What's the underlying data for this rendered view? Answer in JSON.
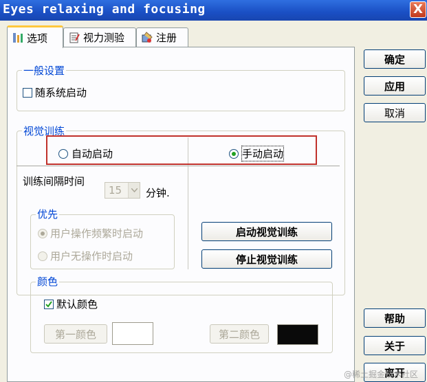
{
  "window": {
    "title": "Eyes relaxing and focusing",
    "close_glyph": "X"
  },
  "tabs": [
    {
      "label": "选项",
      "icon": "settings-icon",
      "active": true
    },
    {
      "label": "视力测验",
      "icon": "document-icon",
      "active": false
    },
    {
      "label": "注册",
      "icon": "register-icon",
      "active": false
    }
  ],
  "general": {
    "title": "一般设置",
    "startup_label": "随系统启动",
    "startup_checked": false
  },
  "training": {
    "title": "视觉训练",
    "auto_label": "自动启动",
    "manual_label": "手动启动",
    "selected_mode": "manual",
    "interval_label": "训练间隔时间",
    "interval_value": "15",
    "interval_unit": "分钟.",
    "priority": {
      "title": "优先",
      "option1": "用户操作频繁时启动",
      "option2": "用户无操作时启动",
      "selected": 1
    },
    "start_button": "启动视觉训练",
    "stop_button": "停止视觉训练"
  },
  "colors": {
    "title": "颜色",
    "default_label": "默认颜色",
    "default_checked": true,
    "first_button": "第一颜色",
    "second_button": "第二颜色",
    "first_swatch": "#ffffff",
    "second_swatch": "#0a0a0a"
  },
  "right_buttons": {
    "ok": "确定",
    "apply": "应用",
    "cancel": "取消",
    "help": "帮助",
    "about": "关于",
    "exit": "离开"
  },
  "highlight_color": "#c0302a",
  "watermark": "@稀土掘金技术社区"
}
